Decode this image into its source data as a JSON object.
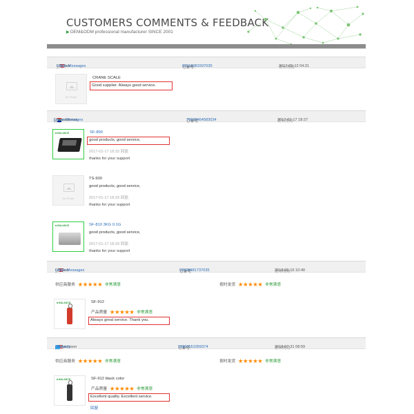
{
  "banner": {
    "title": "CUSTOMERS COMMENTS & FEEDBACK",
    "subtitle": "OEM&ODM professional manufacturer SINCE 2001"
  },
  "labels": {
    "buyer": "买家:",
    "order_no": "订单号:",
    "published": "发布时间:",
    "reply": "回复:",
    "no_photo": "No Photo",
    "supplier_service": "供应商服务",
    "on_time_shipping": "按时发货",
    "product_quality": "产品质量",
    "very_satisfied": "非常满意"
  },
  "orders": [
    {
      "buyer_name": "GR Tarr",
      "flag": "us",
      "status": "Leave Messages",
      "order_no": "82519381597035",
      "time": "2017-05-12 04:21",
      "items": [
        {
          "name": "CRANE SCALE",
          "comment": "Good supplier. Always good service."
        }
      ]
    },
    {
      "buyer_name": "jack cardenas",
      "flag": "za",
      "status": "Leave Messages",
      "order_no": "76692464583034",
      "time": "2017-01-17 18:27",
      "items": [
        {
          "name": "SF-890",
          "comment": "good products, good service,",
          "reply_date": "2017-01-17 18:33",
          "reply": "thanks for your support"
        },
        {
          "name": "TS-500",
          "comment": "good products, good service,",
          "reply_date": "2017-01-17 18:33",
          "reply": "thanks for your support"
        },
        {
          "name": "SF-810 3KG 0.1G",
          "comment": "good products, good service,",
          "reply_date": "2017-01-17 18:33",
          "reply": "thanks for your support"
        }
      ]
    },
    {
      "buyer_name": "GR Tarr",
      "flag": "us",
      "status": "Leave Messages",
      "order_no": "92028481737035",
      "time": "2018-06-15 10:40",
      "ratings": {
        "supplier_service": 5,
        "on_time_shipping": 5
      },
      "items": [
        {
          "name": "SF-912",
          "quality": 5,
          "comment": "Always great service. Thank you."
        }
      ]
    },
    {
      "buyer_name": "Al Hutchison",
      "flag": "us",
      "status": "I'm Away",
      "order_no": "92807651059374",
      "time": "2018-07-31 08:59",
      "ratings": {
        "supplier_service": 5,
        "on_time_shipping": 5
      },
      "items": [
        {
          "name": "SF-912 black color",
          "quality": 5,
          "comment": "Excellent quality. Excellent service.",
          "reply_label": "回复"
        }
      ]
    }
  ],
  "colors": {
    "highlight": "#e23030",
    "stars": "#ff8a00",
    "verdict": "#2e9c3b",
    "link": "#2a6cb8"
  }
}
